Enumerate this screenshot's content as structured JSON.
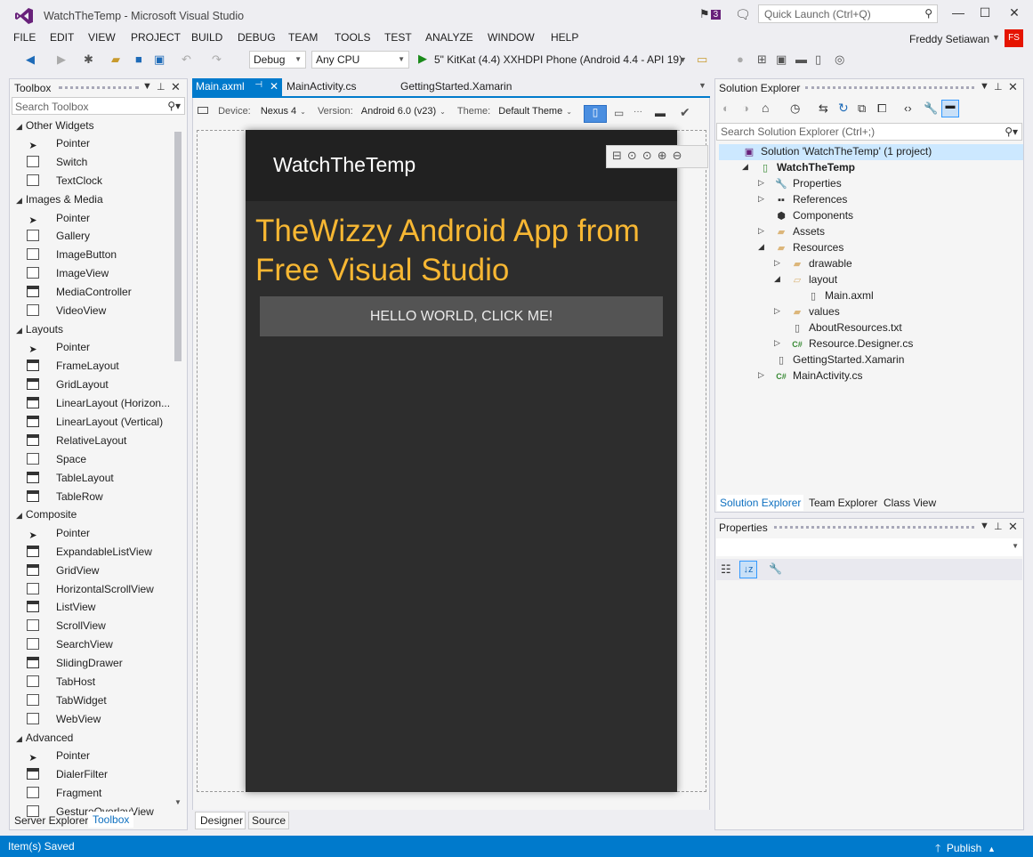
{
  "window": {
    "title": "WatchTheTemp - Microsoft Visual Studio",
    "notification_count": "3",
    "quick_launch_placeholder": "Quick Launch (Ctrl+Q)",
    "user_name": "Freddy Setiawan",
    "avatar_initials": "FS"
  },
  "menu": [
    "FILE",
    "EDIT",
    "VIEW",
    "PROJECT",
    "BUILD",
    "DEBUG",
    "TEAM",
    "TOOLS",
    "TEST",
    "ANALYZE",
    "WINDOW",
    "HELP"
  ],
  "toolbar": {
    "configuration": "Debug",
    "platform": "Any CPU",
    "run_target": "5\" KitKat (4.4) XXHDPI Phone (Android 4.4 - API 19)"
  },
  "toolbox": {
    "title": "Toolbox",
    "search_placeholder": "Search Toolbox",
    "groups": [
      {
        "name": "Other Widgets",
        "items": [
          {
            "label": "Pointer",
            "icon": "pointer"
          },
          {
            "label": "Switch",
            "icon": "box"
          },
          {
            "label": "TextClock",
            "icon": "box"
          }
        ]
      },
      {
        "name": "Images & Media",
        "items": [
          {
            "label": "Pointer",
            "icon": "pointer"
          },
          {
            "label": "Gallery",
            "icon": "box"
          },
          {
            "label": "ImageButton",
            "icon": "box"
          },
          {
            "label": "ImageView",
            "icon": "box"
          },
          {
            "label": "MediaController",
            "icon": "grid"
          },
          {
            "label": "VideoView",
            "icon": "box"
          }
        ]
      },
      {
        "name": "Layouts",
        "items": [
          {
            "label": "Pointer",
            "icon": "pointer"
          },
          {
            "label": "FrameLayout",
            "icon": "grid"
          },
          {
            "label": "GridLayout",
            "icon": "grid"
          },
          {
            "label": "LinearLayout (Horizon...",
            "icon": "grid"
          },
          {
            "label": "LinearLayout (Vertical)",
            "icon": "grid"
          },
          {
            "label": "RelativeLayout",
            "icon": "grid"
          },
          {
            "label": "Space",
            "icon": "box"
          },
          {
            "label": "TableLayout",
            "icon": "grid"
          },
          {
            "label": "TableRow",
            "icon": "grid"
          }
        ]
      },
      {
        "name": "Composite",
        "items": [
          {
            "label": "Pointer",
            "icon": "pointer"
          },
          {
            "label": "ExpandableListView",
            "icon": "grid"
          },
          {
            "label": "GridView",
            "icon": "grid"
          },
          {
            "label": "HorizontalScrollView",
            "icon": "box"
          },
          {
            "label": "ListView",
            "icon": "grid"
          },
          {
            "label": "ScrollView",
            "icon": "box"
          },
          {
            "label": "SearchView",
            "icon": "box"
          },
          {
            "label": "SlidingDrawer",
            "icon": "grid"
          },
          {
            "label": "TabHost",
            "icon": "box"
          },
          {
            "label": "TabWidget",
            "icon": "box"
          },
          {
            "label": "WebView",
            "icon": "box"
          }
        ]
      },
      {
        "name": "Advanced",
        "items": [
          {
            "label": "Pointer",
            "icon": "pointer"
          },
          {
            "label": "DialerFilter",
            "icon": "grid"
          },
          {
            "label": "Fragment",
            "icon": "box"
          },
          {
            "label": "GestureOverlayView",
            "icon": "box"
          }
        ]
      }
    ],
    "bottom_tabs": [
      "Server Explorer",
      "Toolbox"
    ]
  },
  "editor": {
    "tabs": [
      "Main.axml",
      "MainActivity.cs",
      "GettingStarted.Xamarin"
    ],
    "device_label": "Device:",
    "device_value": "Nexus 4",
    "version_label": "Version:",
    "version_value": "Android 6.0 (v23)",
    "theme_label": "Theme:",
    "theme_value": "Default Theme",
    "bottom_tabs": [
      "Designer",
      "Source"
    ]
  },
  "app_preview": {
    "title": "WatchTheTemp",
    "heading": "TheWizzy Android App from Free Visual Studio",
    "button_label": "HELLO WORLD, CLICK ME!",
    "heading_color": "#f7b733"
  },
  "solution_explorer": {
    "title": "Solution Explorer",
    "search_placeholder": "Search Solution Explorer (Ctrl+;)",
    "items": [
      {
        "label": "Solution 'WatchTheTemp' (1 project)",
        "icon": "solution",
        "depth": 0,
        "expander": ""
      },
      {
        "label": "WatchTheTemp",
        "icon": "project",
        "depth": 1,
        "expander": "open",
        "bold": true
      },
      {
        "label": "Properties",
        "icon": "wrench",
        "depth": 2,
        "expander": "closed"
      },
      {
        "label": "References",
        "icon": "references",
        "depth": 2,
        "expander": "closed"
      },
      {
        "label": "Components",
        "icon": "components",
        "depth": 2,
        "expander": ""
      },
      {
        "label": "Assets",
        "icon": "folder",
        "depth": 2,
        "expander": "closed"
      },
      {
        "label": "Resources",
        "icon": "folder",
        "depth": 2,
        "expander": "open"
      },
      {
        "label": "drawable",
        "icon": "folder",
        "depth": 3,
        "expander": "closed"
      },
      {
        "label": "layout",
        "icon": "folder-open",
        "depth": 3,
        "expander": "open"
      },
      {
        "label": "Main.axml",
        "icon": "file",
        "depth": 4,
        "expander": ""
      },
      {
        "label": "values",
        "icon": "folder",
        "depth": 3,
        "expander": "closed"
      },
      {
        "label": "AboutResources.txt",
        "icon": "file",
        "depth": 3,
        "expander": ""
      },
      {
        "label": "Resource.Designer.cs",
        "icon": "csharp",
        "depth": 3,
        "expander": "closed"
      },
      {
        "label": "GettingStarted.Xamarin",
        "icon": "file",
        "depth": 2,
        "expander": ""
      },
      {
        "label": "MainActivity.cs",
        "icon": "csharp",
        "depth": 2,
        "expander": "closed"
      }
    ],
    "bottom_tabs": [
      "Solution Explorer",
      "Team Explorer",
      "Class View"
    ]
  },
  "properties": {
    "title": "Properties"
  },
  "status": {
    "text": "Item(s) Saved",
    "publish": "Publish"
  },
  "colors": {
    "accent": "#007acc",
    "vs_purple": "#68217a",
    "selection": "#cce8ff"
  }
}
